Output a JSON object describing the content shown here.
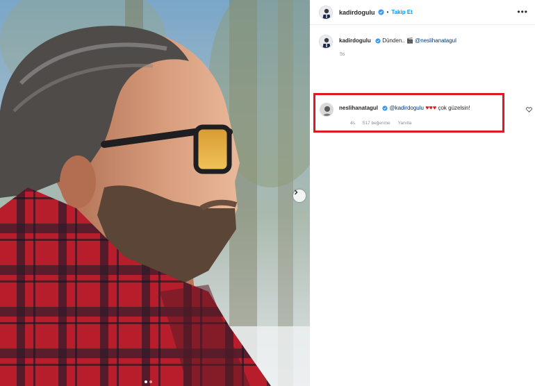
{
  "post": {
    "author": "kadirdogulu",
    "follow_label": "Takip Et",
    "separator": "•",
    "more_label": "•••"
  },
  "caption": {
    "username": "kadirdogulu",
    "text": "Dünden..",
    "emoji": "🎬",
    "mention": "@neslihanatagul",
    "time": "5s"
  },
  "comment": {
    "username": "neslihanatagul",
    "mention": "@kadirdogulu",
    "hearts": "♥♥♥",
    "text": "çok güzelsin!",
    "time": "4s",
    "likes": "517 beğenme",
    "reply_label": "Yanıtla"
  },
  "colors": {
    "accent_blue": "#0095f6",
    "highlight_red": "#e0191f",
    "verified_blue": "#3897f0"
  },
  "icons": [
    "verified-badge-icon",
    "more-options-icon",
    "next-arrow-icon",
    "heart-icon"
  ]
}
